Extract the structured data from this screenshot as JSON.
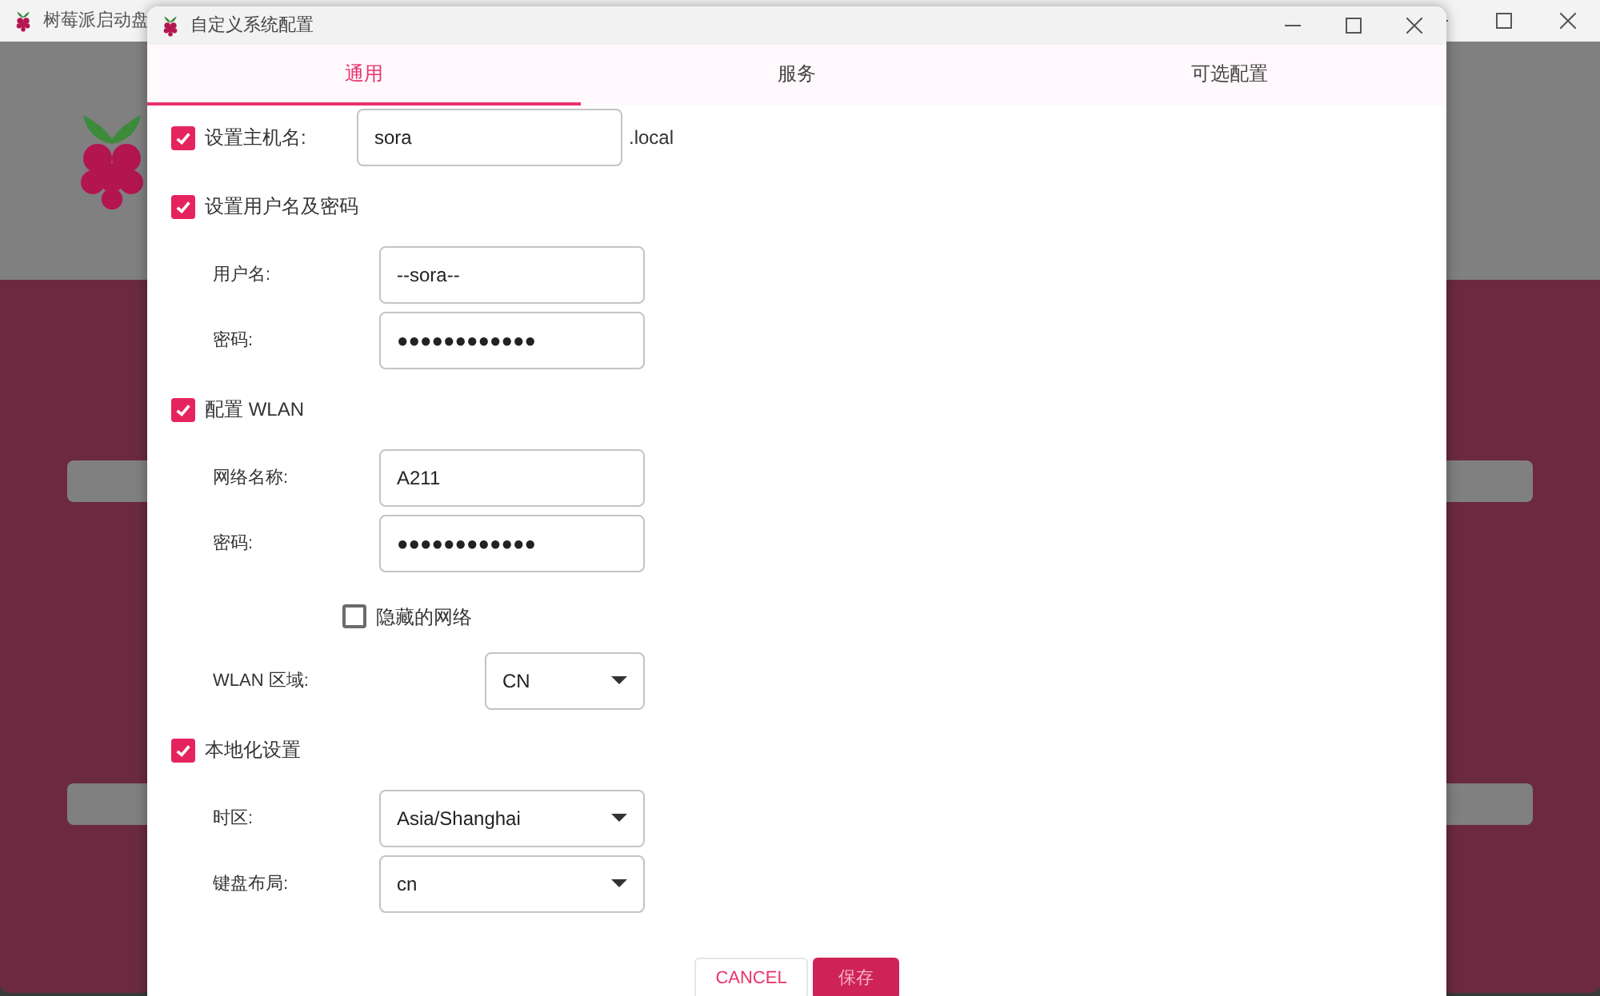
{
  "background_window": {
    "title": "树莓派启动盘"
  },
  "dialog": {
    "title": "自定义系统配置",
    "tabs": [
      {
        "label": "通用",
        "selected": true
      },
      {
        "label": "服务",
        "selected": false
      },
      {
        "label": "可选配置",
        "selected": false
      }
    ],
    "rows": [
      {
        "kind": "checkbox_field",
        "label": "设置主机名:",
        "checked": true,
        "value": "sora",
        "suffix": ".local"
      },
      {
        "kind": "heading",
        "label": "设置用户名及密码",
        "checked": true
      },
      {
        "kind": "field",
        "label": "用户名:",
        "value": "--sora--"
      },
      {
        "kind": "field",
        "label": "密码:",
        "value": "●●●●●●●●●●●●"
      },
      {
        "kind": "heading",
        "label": "配置 WLAN",
        "checked": true
      },
      {
        "kind": "field",
        "label": "网络名称:",
        "value": "A211"
      },
      {
        "kind": "field",
        "label": "密码:",
        "value": "●●●●●●●●●●●●"
      },
      {
        "kind": "option",
        "label": "隐藏的网络",
        "checked": false
      },
      {
        "kind": "short_select",
        "label": "WLAN 区域:",
        "value": "CN"
      },
      {
        "kind": "heading",
        "label": "本地化设置",
        "checked": true
      },
      {
        "kind": "select",
        "label": "时区:",
        "value": "Asia/Shanghai"
      },
      {
        "kind": "select",
        "label": "键盘布局:",
        "value": "cn"
      }
    ],
    "buttons": [
      {
        "label": "CANCEL",
        "kind": "secondary"
      },
      {
        "label": "保存",
        "kind": "primary"
      }
    ]
  }
}
